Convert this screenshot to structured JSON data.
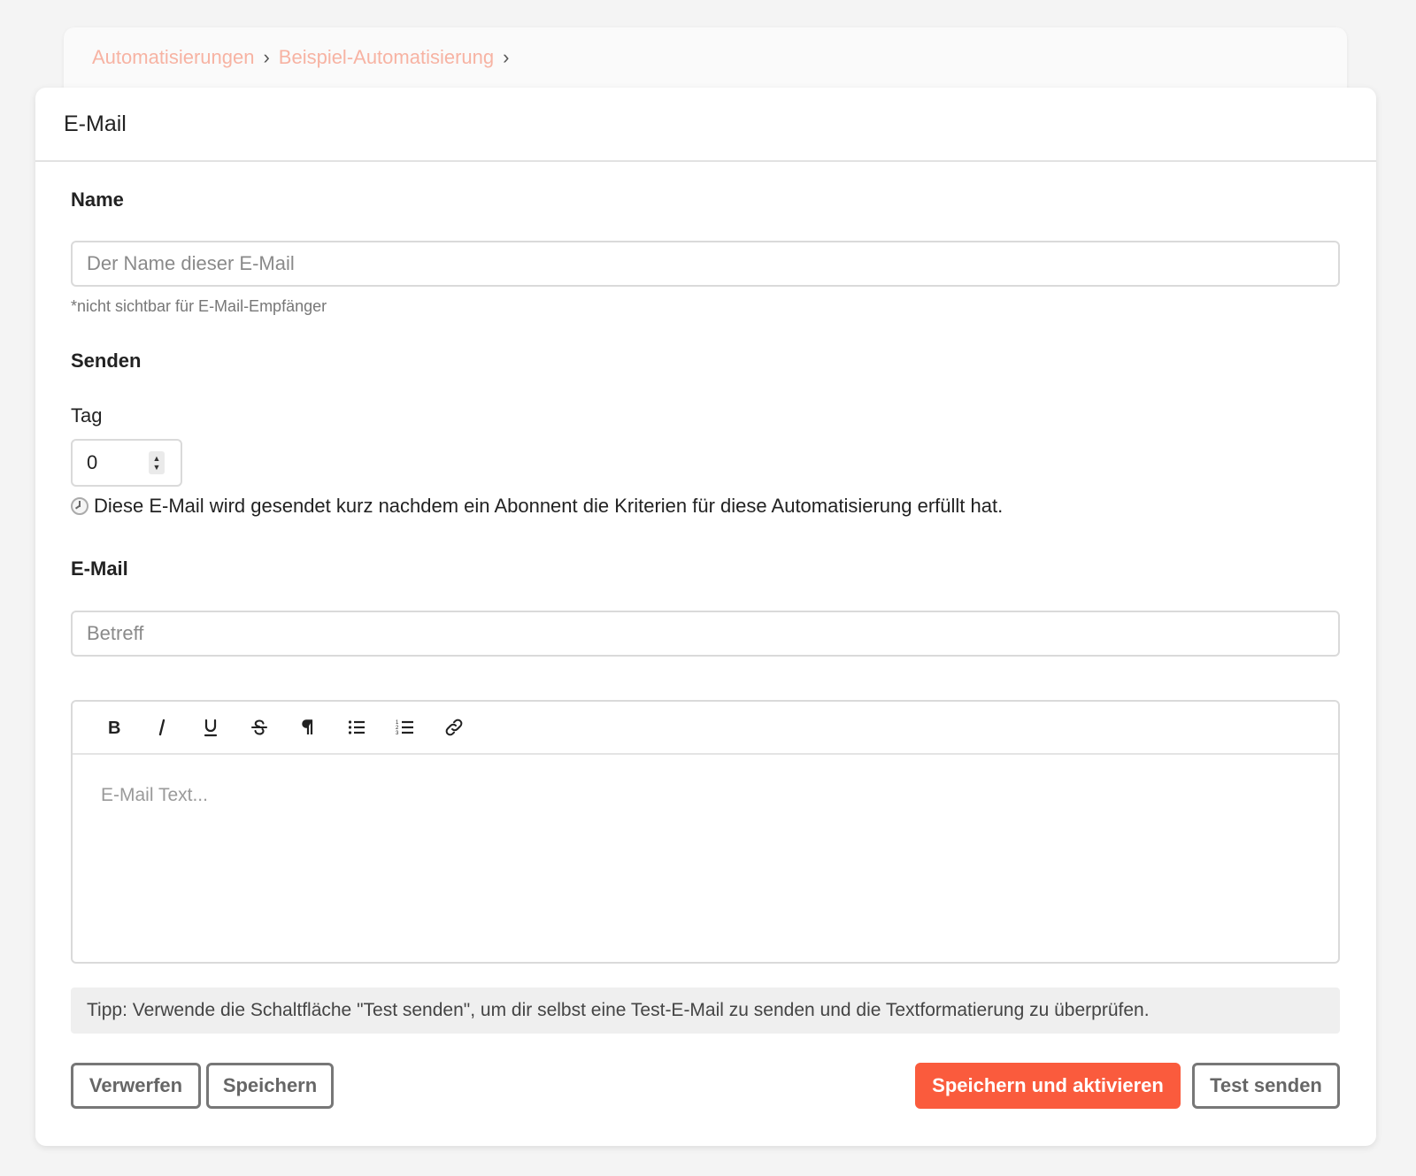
{
  "breadcrumb": {
    "items": [
      "Automatisierungen",
      "Beispiel-Automatisierung"
    ],
    "separator": "›"
  },
  "card": {
    "title": "E-Mail"
  },
  "name_section": {
    "label": "Name",
    "placeholder": "Der Name dieser E-Mail",
    "hint": "*nicht sichtbar für E-Mail-Empfänger"
  },
  "send_section": {
    "label": "Senden",
    "day_label": "Tag",
    "day_value": "0",
    "info": "Diese E-Mail wird gesendet kurz nachdem ein Abonnent die Kriterien für diese Automatisierung erfüllt hat."
  },
  "email_section": {
    "label": "E-Mail",
    "subject_placeholder": "Betreff",
    "body_placeholder": "E-Mail Text...",
    "toolbar": [
      "bold-icon",
      "italic-icon",
      "underline-icon",
      "strikethrough-icon",
      "paragraph-icon",
      "bullet-list-icon",
      "numbered-list-icon",
      "link-icon"
    ]
  },
  "tip": "Tipp: Verwende die Schaltfläche \"Test senden\", um dir selbst eine Test-E-Mail zu senden und die Textformatierung zu überprüfen.",
  "buttons": {
    "discard": "Verwerfen",
    "save": "Speichern",
    "save_activate": "Speichern und aktivieren",
    "send_test": "Test senden"
  },
  "colors": {
    "accent": "#fa5b3d",
    "breadcrumb": "#f7b3a3"
  }
}
